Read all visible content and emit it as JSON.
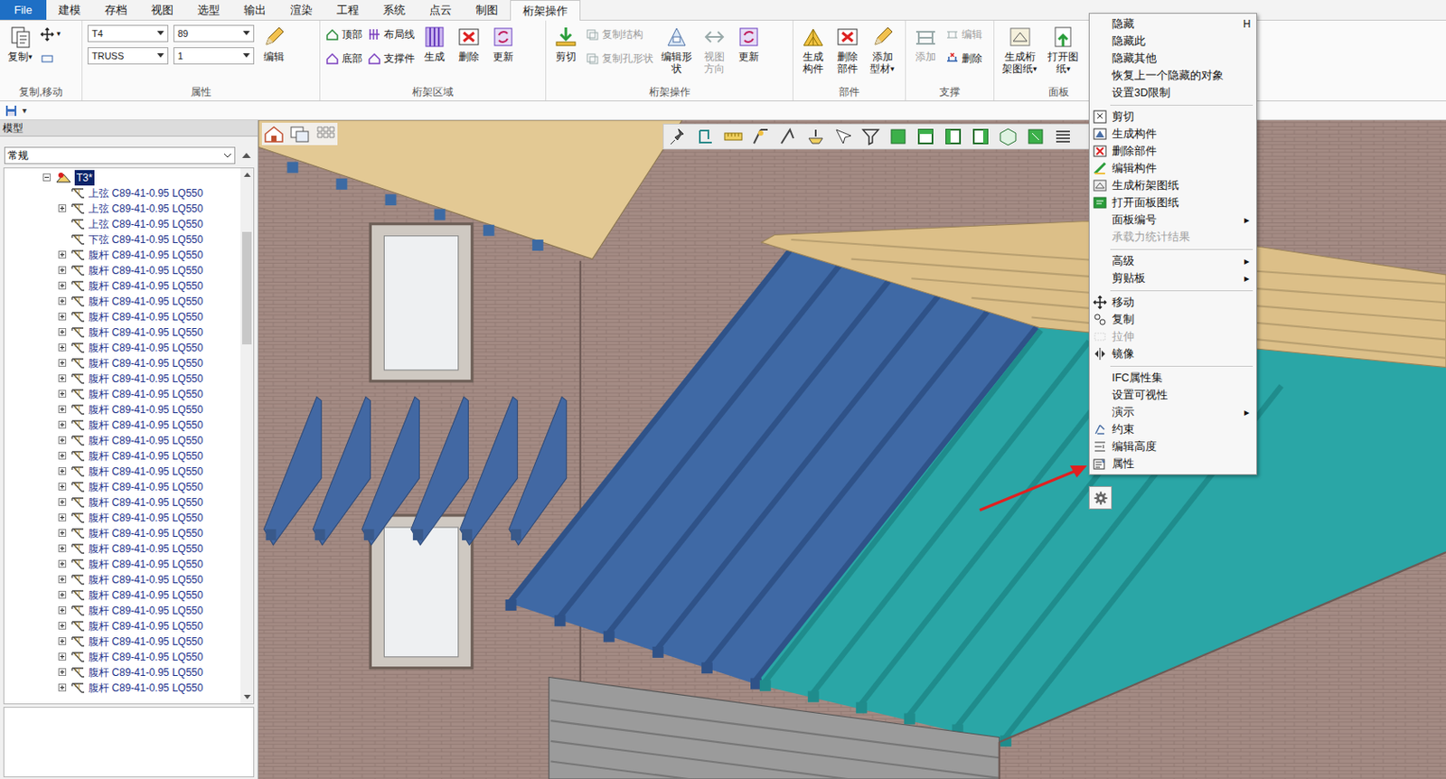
{
  "ribbon_tabs": [
    {
      "label": "File",
      "selected": false,
      "kind": "file"
    },
    {
      "label": "建模",
      "selected": false,
      "kind": "tab"
    },
    {
      "label": "存档",
      "selected": false,
      "kind": "tab"
    },
    {
      "label": "视图",
      "selected": false,
      "kind": "tab"
    },
    {
      "label": "选型",
      "selected": false,
      "kind": "tab"
    },
    {
      "label": "输出",
      "selected": false,
      "kind": "tab"
    },
    {
      "label": "渲染",
      "selected": false,
      "kind": "tab"
    },
    {
      "label": "工程",
      "selected": false,
      "kind": "tab"
    },
    {
      "label": "系统",
      "selected": false,
      "kind": "tab"
    },
    {
      "label": "点云",
      "selected": false,
      "kind": "tab"
    },
    {
      "label": "制图",
      "selected": false,
      "kind": "tab"
    },
    {
      "label": "桁架操作",
      "selected": true,
      "kind": "tab"
    }
  ],
  "ribbon_groups": [
    {
      "label": "复制,移动",
      "columns": [
        [
          {
            "kind": "big",
            "lines": [
              "复制"
            ],
            "arrow": "▾",
            "disabled": false
          }
        ],
        [
          {
            "kind": "icon",
            "arrow": "▾",
            "disabled": false
          },
          {
            "kind": "icon",
            "disabled": false
          }
        ]
      ]
    },
    {
      "label": "属性",
      "columns": [
        [
          {
            "kind": "combo",
            "value": "T4",
            "disabled": false
          },
          {
            "kind": "combo",
            "value": "TRUSS",
            "disabled": false
          }
        ],
        [
          {
            "kind": "combo",
            "value": "89",
            "disabled": false
          },
          {
            "kind": "combo",
            "value": "1",
            "disabled": false
          }
        ],
        [
          {
            "kind": "big",
            "lines": [
              "编辑"
            ],
            "disabled": false
          }
        ]
      ]
    },
    {
      "label": "桁架区域",
      "columns": [
        [
          {
            "kind": "small",
            "label": "顶部",
            "disabled": false
          },
          {
            "kind": "small",
            "label": "底部",
            "disabled": false
          }
        ],
        [
          {
            "kind": "small",
            "label": "布局线",
            "disabled": false
          },
          {
            "kind": "small",
            "label": "支撑件",
            "disabled": false
          }
        ],
        [
          {
            "kind": "big",
            "lines": [
              "生成"
            ],
            "disabled": false
          }
        ],
        [
          {
            "kind": "big",
            "lines": [
              "删除"
            ],
            "disabled": false
          }
        ],
        [
          {
            "kind": "big",
            "lines": [
              "更新"
            ],
            "disabled": false
          }
        ]
      ]
    },
    {
      "label": "桁架操作",
      "columns": [
        [
          {
            "kind": "big",
            "lines": [
              "剪切"
            ],
            "disabled": false
          }
        ],
        [
          {
            "kind": "small",
            "label": "复制结构",
            "disabled": true
          },
          {
            "kind": "small",
            "label": "复制孔形状",
            "disabled": true
          }
        ],
        [
          {
            "kind": "big",
            "lines": [
              "编辑形",
              "状"
            ],
            "disabled": false
          }
        ],
        [
          {
            "kind": "big",
            "lines": [
              "视图",
              "方向"
            ],
            "disabled": true
          }
        ],
        [
          {
            "kind": "big",
            "lines": [
              "更新"
            ],
            "disabled": false
          }
        ]
      ]
    },
    {
      "label": "部件",
      "columns": [
        [
          {
            "kind": "big",
            "lines": [
              "生成",
              "构件"
            ],
            "disabled": false
          }
        ],
        [
          {
            "kind": "big",
            "lines": [
              "删除",
              "部件"
            ],
            "disabled": false
          }
        ],
        [
          {
            "kind": "big",
            "lines": [
              "添加",
              "型材"
            ],
            "arrow": "▾",
            "disabled": false
          }
        ]
      ]
    },
    {
      "label": "支撑",
      "columns": [
        [
          {
            "kind": "big",
            "lines": [
              "添加"
            ],
            "disabled": true
          }
        ],
        [
          {
            "kind": "small",
            "label": "编辑",
            "disabled": true
          },
          {
            "kind": "small",
            "label": "删除",
            "disabled": false
          }
        ]
      ]
    },
    {
      "label": "面板",
      "columns": [
        [
          {
            "kind": "big",
            "lines": [
              "生成桁",
              "架图纸"
            ],
            "arrow": "▾",
            "disabled": false
          }
        ],
        [
          {
            "kind": "big",
            "lines": [
              "打开图",
              "纸"
            ],
            "arrow": "▾",
            "disabled": false
          }
        ]
      ]
    }
  ],
  "quick_access": {
    "arrow": "▾"
  },
  "model_panel": {
    "title": "模型",
    "filter": "常规",
    "tree": {
      "root": {
        "label": "T3*",
        "expanded": true,
        "selected": true
      },
      "items": [
        {
          "label": "上弦 C89-41-0.95 LQ550",
          "expandable": false
        },
        {
          "label": "上弦 C89-41-0.95 LQ550",
          "expandable": true,
          "expanded": false
        },
        {
          "label": "上弦 C89-41-0.95 LQ550",
          "expandable": false
        },
        {
          "label": "下弦 C89-41-0.95 LQ550",
          "expandable": false
        },
        {
          "label": "腹杆 C89-41-0.95 LQ550",
          "expandable": true,
          "expanded": false
        },
        {
          "label": "腹杆 C89-41-0.95 LQ550",
          "expandable": true,
          "expanded": false
        },
        {
          "label": "腹杆 C89-41-0.95 LQ550",
          "expandable": true,
          "expanded": false
        },
        {
          "label": "腹杆 C89-41-0.95 LQ550",
          "expandable": true,
          "expanded": false
        },
        {
          "label": "腹杆 C89-41-0.95 LQ550",
          "expandable": true,
          "expanded": false
        },
        {
          "label": "腹杆 C89-41-0.95 LQ550",
          "expandable": true,
          "expanded": false
        },
        {
          "label": "腹杆 C89-41-0.95 LQ550",
          "expandable": true,
          "expanded": false
        },
        {
          "label": "腹杆 C89-41-0.95 LQ550",
          "expandable": true,
          "expanded": false
        },
        {
          "label": "腹杆 C89-41-0.95 LQ550",
          "expandable": true,
          "expanded": false
        },
        {
          "label": "腹杆 C89-41-0.95 LQ550",
          "expandable": true,
          "expanded": false
        },
        {
          "label": "腹杆 C89-41-0.95 LQ550",
          "expandable": true,
          "expanded": false
        },
        {
          "label": "腹杆 C89-41-0.95 LQ550",
          "expandable": true,
          "expanded": false
        },
        {
          "label": "腹杆 C89-41-0.95 LQ550",
          "expandable": true,
          "expanded": false
        },
        {
          "label": "腹杆 C89-41-0.95 LQ550",
          "expandable": true,
          "expanded": false
        },
        {
          "label": "腹杆 C89-41-0.95 LQ550",
          "expandable": true,
          "expanded": false
        },
        {
          "label": "腹杆 C89-41-0.95 LQ550",
          "expandable": true,
          "expanded": false
        },
        {
          "label": "腹杆 C89-41-0.95 LQ550",
          "expandable": true,
          "expanded": false
        },
        {
          "label": "腹杆 C89-41-0.95 LQ550",
          "expandable": true,
          "expanded": false
        },
        {
          "label": "腹杆 C89-41-0.95 LQ550",
          "expandable": true,
          "expanded": false
        },
        {
          "label": "腹杆 C89-41-0.95 LQ550",
          "expandable": true,
          "expanded": false
        },
        {
          "label": "腹杆 C89-41-0.95 LQ550",
          "expandable": true,
          "expanded": false
        },
        {
          "label": "腹杆 C89-41-0.95 LQ550",
          "expandable": true,
          "expanded": false
        },
        {
          "label": "腹杆 C89-41-0.95 LQ550",
          "expandable": true,
          "expanded": false
        },
        {
          "label": "腹杆 C89-41-0.95 LQ550",
          "expandable": true,
          "expanded": false
        },
        {
          "label": "腹杆 C89-41-0.95 LQ550",
          "expandable": true,
          "expanded": false
        },
        {
          "label": "腹杆 C89-41-0.95 LQ550",
          "expandable": true,
          "expanded": false
        },
        {
          "label": "腹杆 C89-41-0.95 LQ550",
          "expandable": true,
          "expanded": false
        },
        {
          "label": "腹杆 C89-41-0.95 LQ550",
          "expandable": true,
          "expanded": false
        },
        {
          "label": "腹杆 C89-41-0.95 LQ550",
          "expandable": true,
          "expanded": false
        }
      ]
    },
    "scrollbar": {
      "level": 0.22,
      "offset": 0.1
    }
  },
  "context_menu": {
    "items": [
      {
        "kind": "item",
        "label": "隐藏",
        "shortcut": "H",
        "has_icon": false,
        "disabled": false
      },
      {
        "kind": "item",
        "label": "隐藏此",
        "has_icon": false,
        "disabled": false
      },
      {
        "kind": "item",
        "label": "隐藏其他",
        "has_icon": false,
        "disabled": false
      },
      {
        "kind": "item",
        "label": "恢复上一个隐藏的对象",
        "has_icon": false,
        "disabled": false
      },
      {
        "kind": "item",
        "label": "设置3D限制",
        "has_icon": false,
        "disabled": false
      },
      {
        "kind": "separator"
      },
      {
        "kind": "item",
        "label": "剪切",
        "has_icon": true,
        "disabled": false
      },
      {
        "kind": "item",
        "label": "生成构件",
        "has_icon": true,
        "disabled": false
      },
      {
        "kind": "item",
        "label": "删除部件",
        "has_icon": true,
        "disabled": false
      },
      {
        "kind": "item",
        "label": "编辑构件",
        "has_icon": true,
        "disabled": false
      },
      {
        "kind": "item",
        "label": "生成桁架图纸",
        "has_icon": true,
        "disabled": false
      },
      {
        "kind": "item",
        "label": "打开面板图纸",
        "has_icon": true,
        "disabled": false
      },
      {
        "kind": "item",
        "label": "面板编号",
        "arrow": "▸",
        "has_icon": false,
        "disabled": false
      },
      {
        "kind": "item",
        "label": "承载力统计结果",
        "has_icon": false,
        "disabled": true
      },
      {
        "kind": "separator"
      },
      {
        "kind": "item",
        "label": "高级",
        "arrow": "▸",
        "has_icon": false,
        "disabled": false
      },
      {
        "kind": "item",
        "label": "剪贴板",
        "arrow": "▸",
        "has_icon": false,
        "disabled": false
      },
      {
        "kind": "separator"
      },
      {
        "kind": "item",
        "label": "移动",
        "has_icon": true,
        "disabled": false
      },
      {
        "kind": "item",
        "label": "复制",
        "has_icon": true,
        "disabled": false
      },
      {
        "kind": "item",
        "label": "拉伸",
        "has_icon": true,
        "disabled": true
      },
      {
        "kind": "item",
        "label": "镜像",
        "has_icon": true,
        "disabled": false
      },
      {
        "kind": "separator"
      },
      {
        "kind": "item",
        "label": "IFC属性集",
        "has_icon": false,
        "disabled": false
      },
      {
        "kind": "item",
        "label": "设置可视性",
        "has_icon": false,
        "disabled": false
      },
      {
        "kind": "item",
        "label": "演示",
        "arrow": "▸",
        "has_icon": false,
        "disabled": false
      },
      {
        "kind": "item",
        "label": "约束",
        "has_icon": true,
        "disabled": false
      },
      {
        "kind": "item",
        "label": "编辑高度",
        "has_icon": true,
        "disabled": false
      },
      {
        "kind": "item",
        "label": "属性",
        "has_icon": true,
        "disabled": false
      }
    ]
  }
}
